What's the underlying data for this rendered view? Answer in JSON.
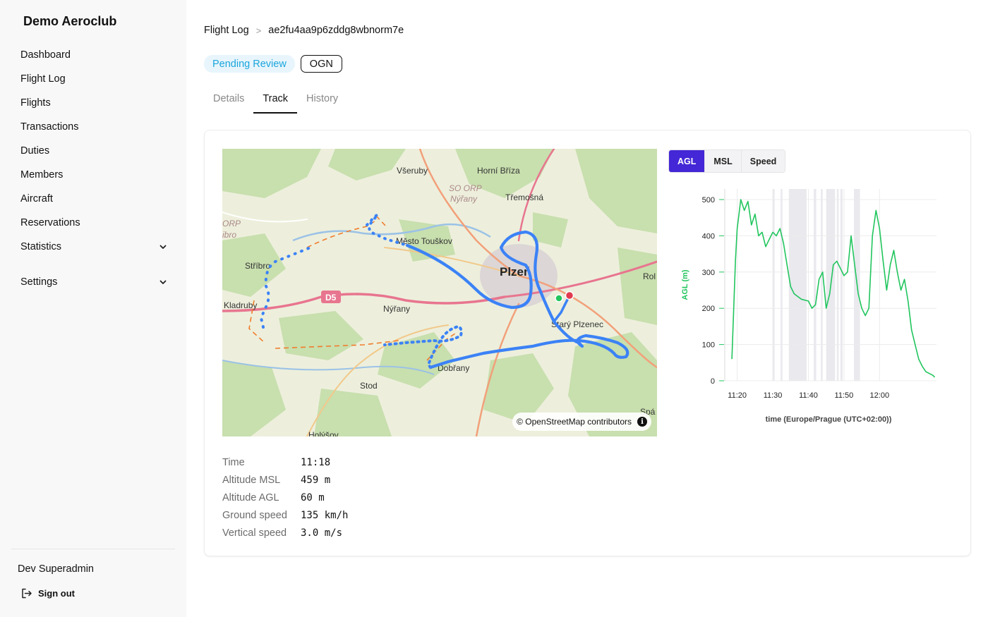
{
  "sidebar": {
    "brand": "Demo Aeroclub",
    "items": [
      {
        "label": "Dashboard"
      },
      {
        "label": "Flight Log"
      },
      {
        "label": "Flights"
      },
      {
        "label": "Transactions"
      },
      {
        "label": "Duties"
      },
      {
        "label": "Members"
      },
      {
        "label": "Aircraft"
      },
      {
        "label": "Reservations"
      },
      {
        "label": "Statistics"
      },
      {
        "label": "Settings"
      }
    ],
    "user": "Dev Superadmin",
    "sign_out": "Sign out"
  },
  "breadcrumb": {
    "parent": "Flight Log",
    "separator": ">",
    "current": "ae2fu4aa9p6zddg8wbnorm7e"
  },
  "badges": {
    "status": "Pending Review",
    "source": "OGN"
  },
  "tabs": [
    {
      "label": "Details",
      "active": false
    },
    {
      "label": "Track",
      "active": true
    },
    {
      "label": "History",
      "active": false
    }
  ],
  "map": {
    "attribution": "© OpenStreetMap contributors",
    "info_symbol": "i",
    "places": [
      {
        "name": "Všeruby"
      },
      {
        "name": "Horní Bříza"
      },
      {
        "name": "SO ORP"
      },
      {
        "name": "Nýřany"
      },
      {
        "name": "Třemošná"
      },
      {
        "name": "ORP"
      },
      {
        "name": "ibro"
      },
      {
        "name": "Město Touškov"
      },
      {
        "name": "Stříbro"
      },
      {
        "name": "Plzeň"
      },
      {
        "name": "Rol"
      },
      {
        "name": "D5"
      },
      {
        "name": "Kladruby"
      },
      {
        "name": "Nýřany"
      },
      {
        "name": "Starý Plzenec"
      },
      {
        "name": "Dobřany"
      },
      {
        "name": "Stod"
      },
      {
        "name": "Spá"
      },
      {
        "name": "Holýšov"
      }
    ]
  },
  "stats": [
    {
      "label": "Time",
      "value": "11:18"
    },
    {
      "label": "Altitude MSL",
      "value": "459 m"
    },
    {
      "label": "Altitude AGL",
      "value": "60 m"
    },
    {
      "label": "Ground speed",
      "value": "135 km/h"
    },
    {
      "label": "Vertical speed",
      "value": "3.0 m/s"
    }
  ],
  "chart_modes": [
    {
      "label": "AGL",
      "active": true
    },
    {
      "label": "MSL",
      "active": false
    },
    {
      "label": "Speed",
      "active": false
    }
  ],
  "colors": {
    "accent": "#4427d6",
    "track": "#3b82f6",
    "chart_line": "#22c55e",
    "pending": "#1ba6dd"
  },
  "chart_data": {
    "type": "line",
    "ylabel": "AGL (m)",
    "xlabel": "time (Europe/Prague (UTC+02:00))",
    "ylim": [
      0,
      500
    ],
    "yticks": [
      0,
      100,
      200,
      300,
      400,
      500
    ],
    "xticks": [
      "11:20",
      "11:30",
      "11:40",
      "11:50",
      "12:00"
    ],
    "x_minutes_after_1100": [
      18.5,
      19.5,
      20,
      21,
      22,
      23,
      24,
      25,
      26,
      27,
      28,
      29,
      30,
      31,
      32,
      33,
      34,
      35,
      36,
      38,
      40,
      41,
      42,
      43,
      44,
      45,
      46,
      47,
      48,
      49,
      50,
      51,
      52,
      53,
      54,
      55,
      56,
      57,
      58,
      59,
      60,
      61,
      62,
      63,
      64,
      65,
      66,
      67,
      68,
      69,
      70,
      71,
      72,
      73,
      74,
      75,
      75.5
    ],
    "values": [
      60,
      330,
      420,
      500,
      470,
      495,
      430,
      460,
      400,
      410,
      370,
      390,
      410,
      400,
      420,
      380,
      320,
      260,
      240,
      225,
      220,
      200,
      210,
      280,
      300,
      200,
      240,
      320,
      330,
      310,
      290,
      300,
      400,
      320,
      240,
      200,
      180,
      200,
      400,
      470,
      420,
      330,
      250,
      320,
      360,
      300,
      250,
      280,
      220,
      140,
      100,
      60,
      40,
      25,
      20,
      15,
      10
    ],
    "shaded_x_ranges": [
      [
        30,
        30.5
      ],
      [
        32.2,
        32.7
      ],
      [
        34.5,
        39.5
      ],
      [
        41.5,
        42.2
      ],
      [
        43.5,
        44
      ],
      [
        45,
        47.5
      ],
      [
        48,
        48.5
      ],
      [
        49,
        49.6
      ],
      [
        52.8,
        54.5
      ]
    ]
  }
}
